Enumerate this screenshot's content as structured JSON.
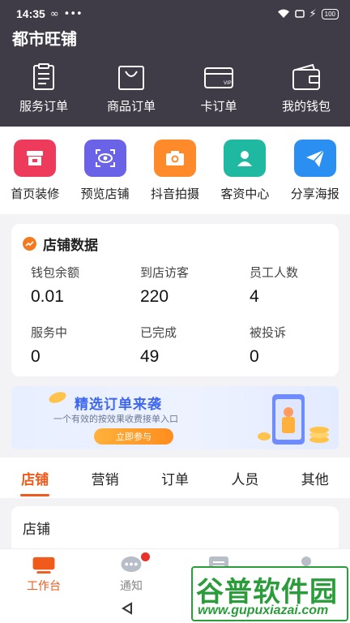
{
  "status_bar": {
    "time": "14:35",
    "battery": "100"
  },
  "app_title": "都市旺铺",
  "quick_actions": [
    {
      "label": "服务订单",
      "icon": "clipboard-icon"
    },
    {
      "label": "商品订单",
      "icon": "shopping-bag-icon"
    },
    {
      "label": "卡订单",
      "icon": "vip-card-icon"
    },
    {
      "label": "我的钱包",
      "icon": "wallet-icon"
    }
  ],
  "tools": [
    {
      "label": "首页装修",
      "icon": "store-icon",
      "color": "#ee3b5c"
    },
    {
      "label": "预览店铺",
      "icon": "eye-scan-icon",
      "color": "#6a63e8"
    },
    {
      "label": "抖音拍摄",
      "icon": "camera-icon",
      "color": "#ff8a2a"
    },
    {
      "label": "客资中心",
      "icon": "contact-card-icon",
      "color": "#1fb8a0"
    },
    {
      "label": "分享海报",
      "icon": "paper-plane-icon",
      "color": "#2a8ff0"
    }
  ],
  "store_data": {
    "title": "店铺数据",
    "stats": [
      {
        "label": "钱包余额",
        "value": "0.01"
      },
      {
        "label": "到店访客",
        "value": "220"
      },
      {
        "label": "员工人数",
        "value": "4"
      },
      {
        "label": "服务中",
        "value": "0"
      },
      {
        "label": "已完成",
        "value": "49"
      },
      {
        "label": "被投诉",
        "value": "0"
      }
    ]
  },
  "banner": {
    "title": "精选订单来袭",
    "subtitle": "一个有效的按效果收费接单入口",
    "button": "立即参与"
  },
  "tabs": [
    "店铺",
    "营销",
    "订单",
    "人员",
    "其他"
  ],
  "active_tab": "店铺",
  "section_title": "店铺",
  "bottom_nav": [
    {
      "label": "工作台",
      "icon": "workbench-icon"
    },
    {
      "label": "通知",
      "icon": "chat-bubble-icon"
    },
    {
      "label": "",
      "icon": "list-icon"
    },
    {
      "label": "",
      "icon": "person-icon"
    }
  ],
  "watermark": {
    "line1": "谷普软件园",
    "line2": "www.gupuxiazai.com"
  },
  "colors": {
    "header_bg": "#3f3b47",
    "accent": "#f05a1a"
  }
}
